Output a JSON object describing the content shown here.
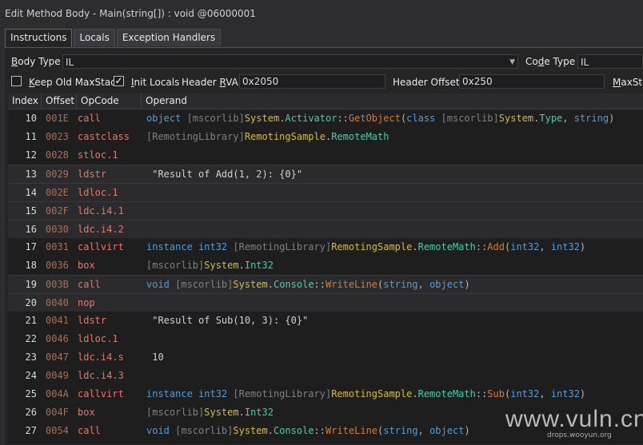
{
  "window": {
    "title": "Edit Method Body - Main(string[]) : void @06000001"
  },
  "tabs": [
    "Instructions",
    "Locals",
    "Exception Handlers"
  ],
  "settings": {
    "body_type_label_u": "B",
    "body_type_label_rest": "ody Type",
    "body_type_value": "IL",
    "code_type_label_a": "Co",
    "code_type_label_u": "d",
    "code_type_label_b": "e Type",
    "code_type_value": "IL",
    "keep_old_maxstack_label_u": "K",
    "keep_old_maxstack_label_rest": "eep Old MaxStack",
    "keep_old_maxstack_checked": false,
    "init_locals_label_u": "I",
    "init_locals_label_rest": "nit Locals",
    "init_locals_checked": true,
    "header_rva_label_a": "Header ",
    "header_rva_label_u": "R",
    "header_rva_label_b": "VA",
    "header_rva_value": "0x2050",
    "header_offset_label": "Header Offset",
    "header_offset_value": "0x250",
    "maxstack_label_u": "M",
    "maxstack_label_rest": "axSta"
  },
  "grid": {
    "columns": [
      "Index",
      "Offset",
      "OpCode",
      "Operand"
    ],
    "rows": [
      {
        "index": "10",
        "offset": "001E",
        "opcode": "call",
        "operand": [
          [
            "kw",
            "object "
          ],
          [
            "asm",
            "[mscorlib]"
          ],
          [
            "ty",
            "System"
          ],
          [
            "pu",
            "."
          ],
          [
            "tyc",
            "Activator"
          ],
          [
            "pu",
            "::"
          ],
          [
            "me",
            "GetObject"
          ],
          [
            "pu",
            "("
          ],
          [
            "kw",
            "class "
          ],
          [
            "asm",
            "[mscorlib]"
          ],
          [
            "ty",
            "System"
          ],
          [
            "pu",
            "."
          ],
          [
            "tyc",
            "Type"
          ],
          [
            "pu",
            ", "
          ],
          [
            "kw",
            "string"
          ],
          [
            "pu",
            ")"
          ]
        ]
      },
      {
        "index": "11",
        "offset": "0023",
        "opcode": "castclass",
        "operand": [
          [
            "asm",
            "[RemotingLibrary]"
          ],
          [
            "ty",
            "RemotingSample"
          ],
          [
            "pu",
            "."
          ],
          [
            "tyc",
            "RemoteMath"
          ]
        ]
      },
      {
        "index": "12",
        "offset": "0028",
        "opcode": "stloc.1",
        "operand": []
      },
      {
        "index": "13",
        "offset": "0029",
        "opcode": "ldstr",
        "operand": [
          [
            "st",
            " \"Result of Add(1, 2): {0}\""
          ]
        ]
      },
      {
        "index": "14",
        "offset": "002E",
        "opcode": "ldloc.1",
        "operand": []
      },
      {
        "index": "15",
        "offset": "002F",
        "opcode": "ldc.i4.1",
        "operand": []
      },
      {
        "index": "16",
        "offset": "0030",
        "opcode": "ldc.i4.2",
        "operand": []
      },
      {
        "index": "17",
        "offset": "0031",
        "opcode": "callvirt",
        "operand": [
          [
            "kw",
            "instance int32 "
          ],
          [
            "asm",
            "[RemotingLibrary]"
          ],
          [
            "ty",
            "RemotingSample"
          ],
          [
            "pu",
            "."
          ],
          [
            "tyc",
            "RemoteMath"
          ],
          [
            "pu",
            "::"
          ],
          [
            "me",
            "Add"
          ],
          [
            "pu",
            "("
          ],
          [
            "kw",
            "int32"
          ],
          [
            "pu",
            ", "
          ],
          [
            "kw",
            "int32"
          ],
          [
            "pu",
            ")"
          ]
        ]
      },
      {
        "index": "18",
        "offset": "0036",
        "opcode": "box",
        "operand": [
          [
            "asm",
            "[mscorlib]"
          ],
          [
            "ty",
            "System"
          ],
          [
            "pu",
            "."
          ],
          [
            "tyc",
            "Int32"
          ]
        ]
      },
      {
        "index": "19",
        "offset": "003B",
        "opcode": "call",
        "operand": [
          [
            "kw",
            "void "
          ],
          [
            "asm",
            "[mscorlib]"
          ],
          [
            "ty",
            "System"
          ],
          [
            "pu",
            "."
          ],
          [
            "tyc",
            "Console"
          ],
          [
            "pu",
            "::"
          ],
          [
            "me",
            "WriteLine"
          ],
          [
            "pu",
            "("
          ],
          [
            "kw",
            "string"
          ],
          [
            "pu",
            ", "
          ],
          [
            "kw",
            "object"
          ],
          [
            "pu",
            ")"
          ]
        ]
      },
      {
        "index": "20",
        "offset": "0040",
        "opcode": "nop",
        "operand": []
      },
      {
        "index": "21",
        "offset": "0041",
        "opcode": "ldstr",
        "operand": [
          [
            "st",
            " \"Result of Sub(10, 3): {0}\""
          ]
        ]
      },
      {
        "index": "22",
        "offset": "0046",
        "opcode": "ldloc.1",
        "operand": []
      },
      {
        "index": "23",
        "offset": "0047",
        "opcode": "ldc.i4.s",
        "operand": [
          [
            "st",
            " 10"
          ]
        ]
      },
      {
        "index": "24",
        "offset": "0049",
        "opcode": "ldc.i4.3",
        "operand": []
      },
      {
        "index": "25",
        "offset": "004A",
        "opcode": "callvirt",
        "operand": [
          [
            "kw",
            "instance int32 "
          ],
          [
            "asm",
            "[RemotingLibrary]"
          ],
          [
            "ty",
            "RemotingSample"
          ],
          [
            "pu",
            "."
          ],
          [
            "tyc",
            "RemoteMath"
          ],
          [
            "pu",
            "::"
          ],
          [
            "me",
            "Sub"
          ],
          [
            "pu",
            "("
          ],
          [
            "kw",
            "int32"
          ],
          [
            "pu",
            ", "
          ],
          [
            "kw",
            "int32"
          ],
          [
            "pu",
            ")"
          ]
        ]
      },
      {
        "index": "26",
        "offset": "004F",
        "opcode": "box",
        "operand": [
          [
            "asm",
            "[mscorlib]"
          ],
          [
            "ty",
            "System"
          ],
          [
            "pu",
            "."
          ],
          [
            "tyc",
            "Int32"
          ]
        ]
      },
      {
        "index": "27",
        "offset": "0054",
        "opcode": "call",
        "operand": [
          [
            "kw",
            "void "
          ],
          [
            "asm",
            "[mscorlib]"
          ],
          [
            "ty",
            "System"
          ],
          [
            "pu",
            "."
          ],
          [
            "tyc",
            "Console"
          ],
          [
            "pu",
            "::"
          ],
          [
            "me",
            "WriteLine"
          ],
          [
            "pu",
            "("
          ],
          [
            "kw",
            "string"
          ],
          [
            "pu",
            ", "
          ],
          [
            "kw",
            "object"
          ],
          [
            "pu",
            ")"
          ]
        ]
      }
    ],
    "highlighted_rows": [
      "13",
      "14",
      "15",
      "16",
      "19",
      "20"
    ]
  },
  "watermark": {
    "main": "www.vuln.cn",
    "sub": "drops.wooyun.org"
  }
}
